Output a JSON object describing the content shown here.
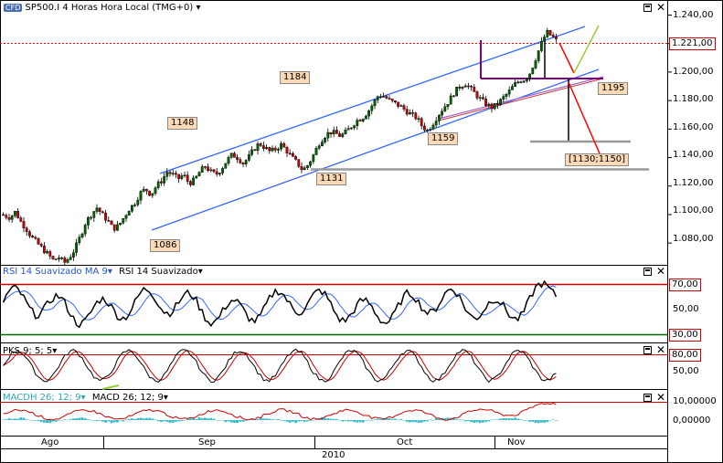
{
  "header": {
    "logo_text": "CFD",
    "instrument": "SP500.I 4 Horas Hora Local (TMG+0)"
  },
  "colors": {
    "bull": "#006600",
    "bear": "#cc0000",
    "channel": "#3366ff",
    "rsi": "#000000",
    "rsi_ma": "#3366ff",
    "stoch_k": "#000000",
    "stoch_d": "#cc0000",
    "macd_hist": "#33bbcc",
    "macd_line": "#cc0000",
    "purple": "#800080",
    "grey_level": "#999999",
    "green_arrow": "#99cc33",
    "red_line": "#ff0000",
    "tag_bg": "#fbd9b5"
  },
  "price_panel": {
    "y_labels": [
      "1.240,00",
      "1.221,00",
      "1.200,00",
      "1.180,00",
      "1.160,00",
      "1.140,00",
      "1.120,00",
      "1.100,00",
      "1.080,00"
    ],
    "current_price": "1.221,00",
    "annotations": [
      "1184",
      "1148",
      "1195",
      "1159",
      "1131",
      "1086",
      "[1130;1150]"
    ]
  },
  "rsi_panel": {
    "title_a": "RSI 14 Suavizado MA 9",
    "title_b": "RSI 14 Suavizado",
    "y_labels": [
      "70,00",
      "50,00",
      "30,00"
    ]
  },
  "stoch_panel": {
    "title": "PKS 9; 5; 5",
    "y_labels": [
      "80,00",
      "50,00"
    ]
  },
  "macd_panel": {
    "title_a": "MACDH 26; 12; 9",
    "title_b": "MACD 26; 12; 9",
    "y_labels": [
      "10,00000",
      "0,00000"
    ]
  },
  "x_axis": {
    "months": [
      "Ago",
      "Sep",
      "Oct",
      "Nov"
    ],
    "year": "2010"
  },
  "chart_data": {
    "type": "candlestick",
    "instrument": "SP500.I",
    "timeframe": "4 Horas",
    "price_ylim": [
      1066,
      1248
    ],
    "price_x_months": [
      "Ago",
      "Sep",
      "Oct",
      "Nov"
    ],
    "price_path": [
      [
        0,
        1100
      ],
      [
        3,
        1098
      ],
      [
        5,
        1102
      ],
      [
        7,
        1095
      ],
      [
        9,
        1090
      ],
      [
        11,
        1084
      ],
      [
        13,
        1080
      ],
      [
        15,
        1076
      ],
      [
        17,
        1072
      ],
      [
        19,
        1068
      ],
      [
        21,
        1070
      ],
      [
        23,
        1066
      ],
      [
        25,
        1070
      ],
      [
        27,
        1076
      ],
      [
        29,
        1085
      ],
      [
        31,
        1095
      ],
      [
        33,
        1100
      ],
      [
        35,
        1105
      ],
      [
        37,
        1100
      ],
      [
        39,
        1096
      ],
      [
        41,
        1090
      ],
      [
        43,
        1092
      ],
      [
        45,
        1098
      ],
      [
        47,
        1104
      ],
      [
        49,
        1108
      ],
      [
        51,
        1115
      ],
      [
        53,
        1118
      ],
      [
        55,
        1114
      ],
      [
        57,
        1120
      ],
      [
        59,
        1124
      ],
      [
        61,
        1130
      ],
      [
        63,
        1128
      ],
      [
        65,
        1125
      ],
      [
        67,
        1128
      ],
      [
        69,
        1122
      ],
      [
        71,
        1124
      ],
      [
        73,
        1130
      ],
      [
        75,
        1134
      ],
      [
        77,
        1130
      ],
      [
        79,
        1128
      ],
      [
        81,
        1132
      ],
      [
        83,
        1138
      ],
      [
        85,
        1142
      ],
      [
        87,
        1140
      ],
      [
        89,
        1136
      ],
      [
        91,
        1140
      ],
      [
        93,
        1146
      ],
      [
        95,
        1150
      ],
      [
        97,
        1147
      ],
      [
        99,
        1144
      ],
      [
        101,
        1146
      ],
      [
        103,
        1149
      ],
      [
        105,
        1145
      ],
      [
        107,
        1140
      ],
      [
        109,
        1136
      ],
      [
        111,
        1131
      ],
      [
        113,
        1135
      ],
      [
        115,
        1142
      ],
      [
        117,
        1150
      ],
      [
        119,
        1155
      ],
      [
        121,
        1158
      ],
      [
        123,
        1157
      ],
      [
        125,
        1155
      ],
      [
        127,
        1158
      ],
      [
        129,
        1162
      ],
      [
        131,
        1166
      ],
      [
        133,
        1168
      ],
      [
        135,
        1172
      ],
      [
        137,
        1178
      ],
      [
        139,
        1184
      ],
      [
        141,
        1183
      ],
      [
        143,
        1180
      ],
      [
        145,
        1178
      ],
      [
        147,
        1176
      ],
      [
        149,
        1173
      ],
      [
        151,
        1170
      ],
      [
        153,
        1168
      ],
      [
        155,
        1162
      ],
      [
        157,
        1159
      ],
      [
        159,
        1164
      ],
      [
        161,
        1170
      ],
      [
        163,
        1175
      ],
      [
        165,
        1180
      ],
      [
        167,
        1186
      ],
      [
        169,
        1190
      ],
      [
        171,
        1192
      ],
      [
        173,
        1188
      ],
      [
        175,
        1184
      ],
      [
        177,
        1180
      ],
      [
        179,
        1177
      ],
      [
        181,
        1175
      ],
      [
        183,
        1178
      ],
      [
        185,
        1182
      ],
      [
        187,
        1186
      ],
      [
        189,
        1191
      ],
      [
        191,
        1194
      ],
      [
        193,
        1195
      ],
      [
        195,
        1200
      ],
      [
        197,
        1210
      ],
      [
        199,
        1220
      ],
      [
        201,
        1228
      ],
      [
        203,
        1225
      ],
      [
        205,
        1221
      ]
    ],
    "rsi_ylim": [
      20,
      90
    ],
    "rsi_levels": [
      70,
      30
    ],
    "stoch_levels": [
      80,
      50
    ],
    "macd_levels": [
      10,
      0
    ],
    "annotations_values": [
      1184,
      1148,
      1195,
      1159,
      1131,
      1086
    ],
    "target_range": [
      1130,
      1150
    ],
    "last_price": 1221
  }
}
